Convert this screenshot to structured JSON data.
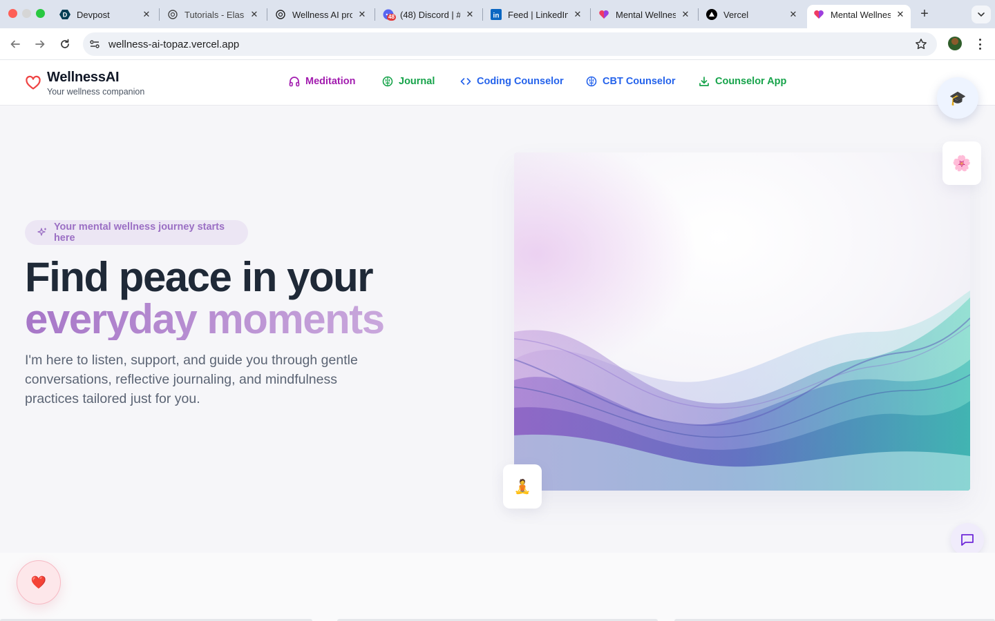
{
  "browser": {
    "tabs": [
      {
        "title": "Devpost",
        "icon": "devpost-icon"
      },
      {
        "title": "Tutorials - Elas",
        "icon": "openai-icon"
      },
      {
        "title": "Wellness AI pro",
        "icon": "openai-icon"
      },
      {
        "title": "(48) Discord | #",
        "icon": "discord-icon",
        "badge": "48"
      },
      {
        "title": "Feed | LinkedIn",
        "icon": "linkedin-icon"
      },
      {
        "title": "Mental Wellnes",
        "icon": "app-heart-icon"
      },
      {
        "title": "Vercel",
        "icon": "vercel-icon"
      },
      {
        "title": "Mental Wellnes",
        "icon": "app-heart-icon",
        "active": true
      }
    ],
    "url": "wellness-ai-topaz.vercel.app"
  },
  "header": {
    "brand": "WellnessAI",
    "tagline": "Your wellness companion",
    "nav": [
      {
        "label": "Meditation",
        "icon": "headphones-icon",
        "color": "#a21caf"
      },
      {
        "label": "Journal",
        "icon": "brain-icon",
        "color": "#16a34a"
      },
      {
        "label": "Coding Counselor",
        "icon": "code-icon",
        "color": "#2563eb"
      },
      {
        "label": "CBT Counselor",
        "icon": "brain-icon",
        "color": "#2563eb"
      },
      {
        "label": "Counselor App",
        "icon": "download-icon",
        "color": "#16a34a"
      }
    ]
  },
  "hero": {
    "badge": "Your mental wellness journey starts here",
    "headline_line1": "Find peace in your",
    "headline_line2": "everyday moments",
    "body": "I'm here to listen, support, and guide you through gentle conversations, reflective journaling, and mindfulness practices tailored just for you."
  },
  "floating": {
    "graduation_emoji": "🎓",
    "flower_emoji": "🌸",
    "yoga_emoji": "🧘",
    "heart_emoji": "❤️"
  },
  "colors": {
    "accent_purple": "#a777c8",
    "heading": "#1f2937",
    "body_text": "#5b6474",
    "hero_bg": "#f6f6f9"
  }
}
